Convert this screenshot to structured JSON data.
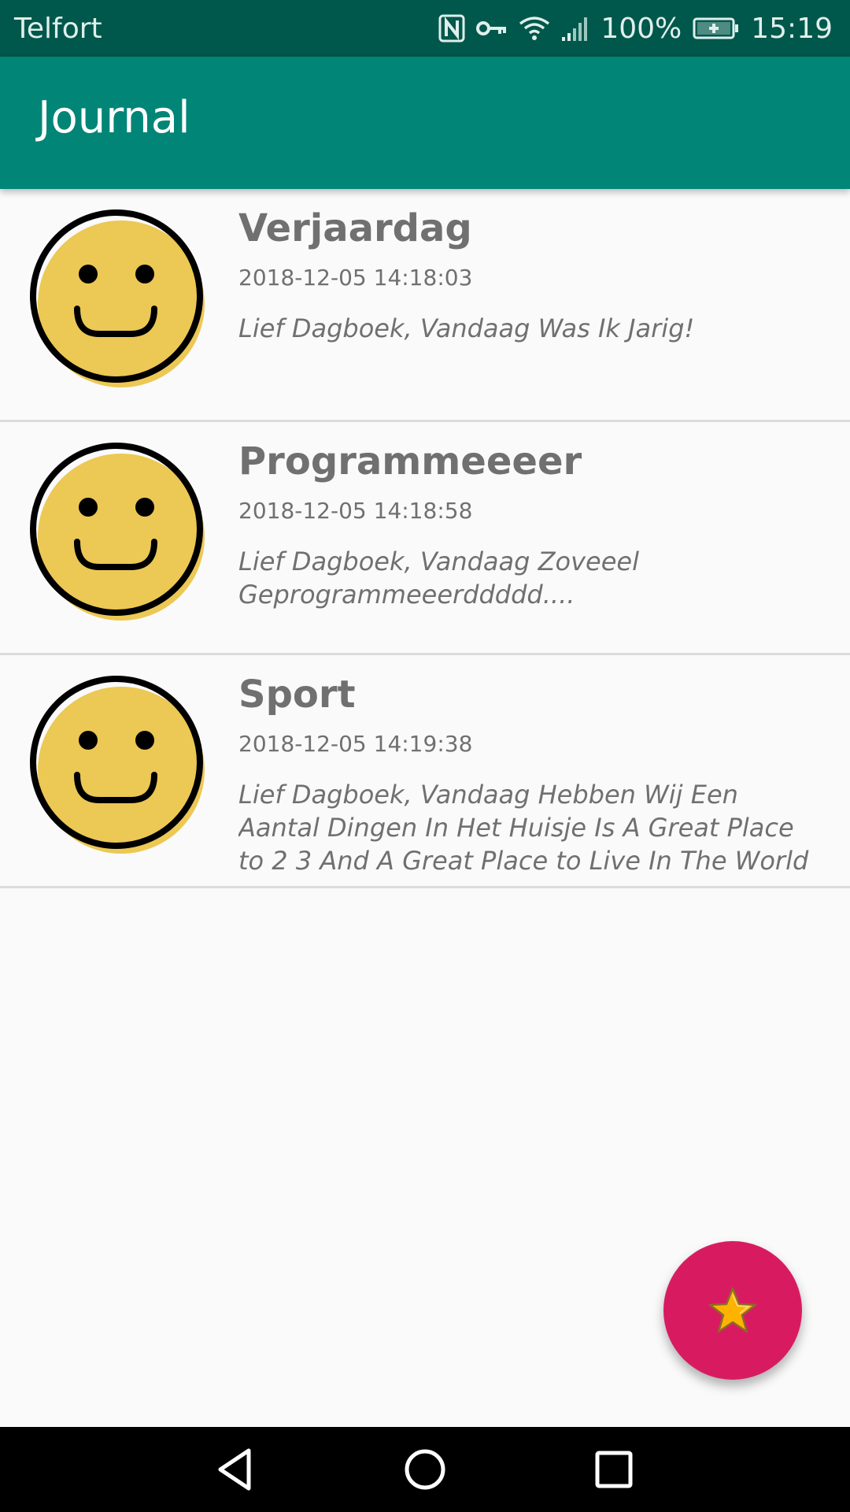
{
  "status_bar": {
    "carrier": "Telfort",
    "battery": "100%",
    "time": "15:19",
    "icons": [
      "nfc-icon",
      "vpn-key-icon",
      "wifi-icon",
      "signal-icon",
      "battery-charging-icon"
    ],
    "background_color": "#00574b"
  },
  "app_bar": {
    "title": "Journal",
    "background_color": "#008577"
  },
  "entries": [
    {
      "title": "Verjaardag",
      "date": "2018-12-05 14:18:03",
      "content": "Lief Dagboek, Vandaag Was Ik Jarig!",
      "mood_icon": "smiley-icon"
    },
    {
      "title": "Programmeeeer",
      "date": "2018-12-05 14:18:58",
      "content": "Lief Dagboek, Vandaag Zoveeel Geprogrammeeerddddd....",
      "mood_icon": "smiley-icon"
    },
    {
      "title": "Sport",
      "date": "2018-12-05 14:19:38",
      "content": "Lief Dagboek, Vandaag Hebben Wij Een Aantal Dingen In Het Huisje Is A Great Place to 2 3 And A Great Place to Live In The World of",
      "mood_icon": "smiley-icon"
    }
  ],
  "fab": {
    "icon": "star-icon",
    "color": "#d81b60"
  },
  "nav_bar": {
    "buttons": [
      "back-icon",
      "home-icon",
      "recents-icon"
    ]
  },
  "colors": {
    "smiley_fill": "#ecc854",
    "text_gray": "#707070",
    "divider": "#dcdcdc"
  }
}
